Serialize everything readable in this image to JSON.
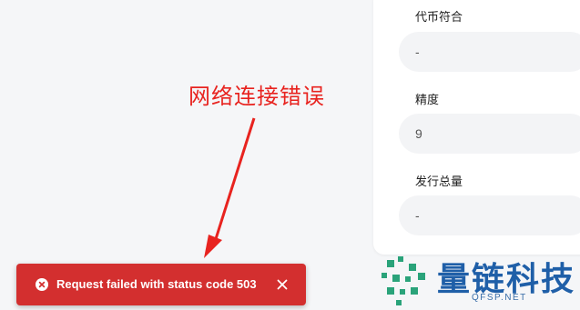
{
  "fields": [
    {
      "label": "代币符合",
      "value": "-"
    },
    {
      "label": "精度",
      "value": "9"
    },
    {
      "label": "发行总量",
      "value": "-"
    }
  ],
  "annotation": {
    "text": "网络连接错误",
    "color": "#e8231f"
  },
  "toast": {
    "message": "Request failed with status code 503",
    "color": "#d32f2f",
    "icon": "error-circle-icon"
  },
  "watermark": {
    "text": "量链科技",
    "sub": "QFSP.NET",
    "color": "#1f5fa8"
  }
}
